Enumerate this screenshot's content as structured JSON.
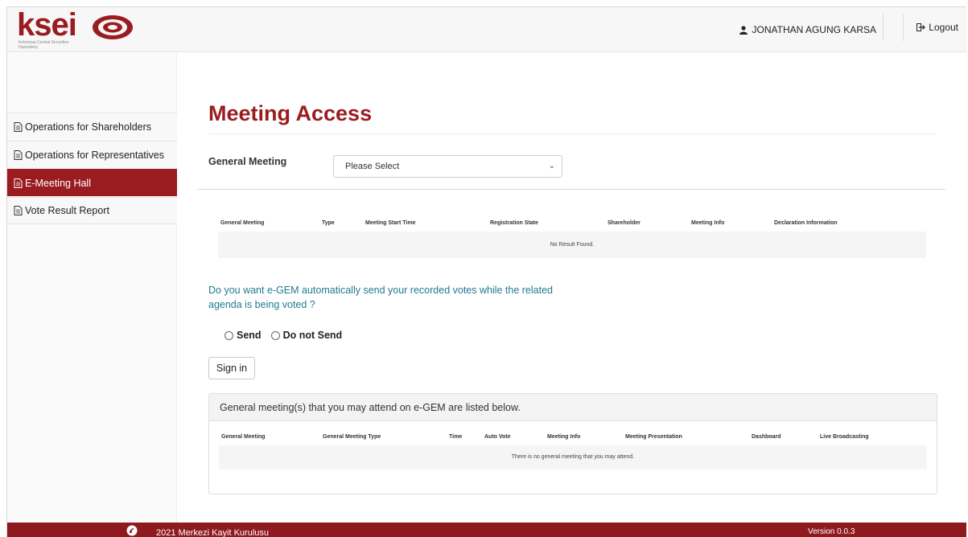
{
  "header": {
    "logo_text": "ksei",
    "logo_subtitle": "Indonesia Central Securities Depository",
    "user_name": "JONATHAN AGUNG KARSA",
    "logout_label": "Logout"
  },
  "sidebar": {
    "items": [
      {
        "label": "Operations for Shareholders",
        "active": false
      },
      {
        "label": "Operations for Representatives",
        "active": false
      },
      {
        "label": "E-Meeting Hall",
        "active": true
      },
      {
        "label": "Vote Result Report",
        "active": false
      }
    ]
  },
  "main": {
    "title": "Meeting Access",
    "general_meeting_label": "General Meeting",
    "general_meeting_select": "Please Select",
    "results_table": {
      "headers": [
        "General Meeting",
        "Type",
        "Meeting Start Time",
        "Registration State",
        "Shareholder",
        "Meeting Info",
        "Declaration Information"
      ],
      "empty_text": "No Result Found."
    },
    "auto_vote_question": "Do you want e-GEM automatically send your recorded votes while the related agenda is being voted ?",
    "radio_send": "Send",
    "radio_do_not_send": "Do not Send",
    "sign_in_label": "Sign in",
    "attend_panel": {
      "heading": "General meeting(s) that you may attend on e-GEM are listed below.",
      "headers": [
        "General Meeting",
        "General Meeting Type",
        "Time",
        "Auto Vote",
        "Meeting Info",
        "Meeting Presentation",
        "Dashboard",
        "Live Broadcasting"
      ],
      "empty_text": "There is no general meeting that you may attend."
    }
  },
  "footer": {
    "copyright": "2021 Merkezi Kayit Kurulusu",
    "version": "Version 0.0.3"
  },
  "colors": {
    "brand": "#9b1c20",
    "footer": "#8e1a1f",
    "question_text": "#1f7b8e"
  }
}
